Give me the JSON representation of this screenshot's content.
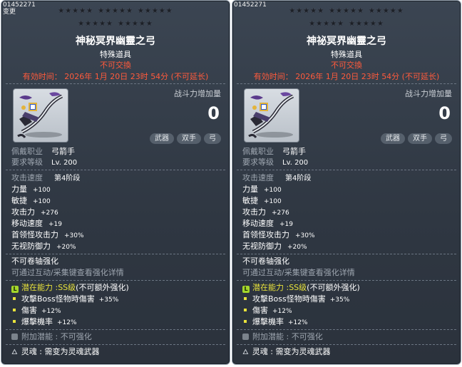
{
  "tooltips": [
    {
      "code": "01452271",
      "sub_code": "变更",
      "stars": [
        "★★★★★",
        "★★★★★",
        "★★★★★",
        "★★★★★",
        "★★★★★"
      ],
      "name": "神秘冥界幽靈之弓",
      "category": "特殊道具",
      "no_trade": "不可交換",
      "expire": "有効时间：  2026年  1月  20日  23时  54分  (不可延长)",
      "power_label": "战斗力增加量",
      "power_value": "0",
      "tags": [
        "武器",
        "双手",
        "弓"
      ],
      "job_label": "佩戴职业",
      "job_value": "弓箭手",
      "level_label": "要求等级",
      "level_value": "Lv. 200",
      "speed_label": "攻击速度",
      "speed_value": "第4阶段",
      "stats": [
        {
          "k": "力量",
          "v": "+100"
        },
        {
          "k": "敏捷",
          "v": "+100"
        },
        {
          "k": "攻击力",
          "v": "+276"
        },
        {
          "k": "移动速度",
          "v": "+19"
        },
        {
          "k": "首领怪攻击力",
          "v": "+30%"
        },
        {
          "k": "无视防御力",
          "v": "+20%"
        }
      ],
      "no_scroll": "不可卷轴强化",
      "scroll_hint": "可通过互动/采集键查看强化详情",
      "potential_label": "潜在能力 : ",
      "potential_grade": "SS级",
      "potential_note": "(不可额外强化)",
      "potentials": [
        {
          "k": "攻擊Boss怪物時傷害",
          "v": "+35%"
        },
        {
          "k": "傷害",
          "v": "+12%"
        },
        {
          "k": "爆擊機率",
          "v": "+12%"
        }
      ],
      "extra_potential": "附加潜能 :  不可强化",
      "soul": "灵魂 :  需变为灵魂武器"
    },
    {
      "code": "01452271",
      "sub_code": "",
      "stars": [
        "★★★★★",
        "★★★★★",
        "★★★★★",
        "★★★★★",
        "★★★★★"
      ],
      "name": "神祕冥界幽靈之弓",
      "category": "特殊道具",
      "no_trade": "不可交換",
      "expire": "有効时间：  2026年  1月  20日  23时  54分  (不可延长)",
      "power_label": "战斗力增加量",
      "power_value": "0",
      "tags": [
        "武器",
        "双手",
        "弓"
      ],
      "job_label": "佩戴职业",
      "job_value": "弓箭手",
      "level_label": "要求等级",
      "level_value": "Lv. 200",
      "speed_label": "攻击速度",
      "speed_value": "第4阶段",
      "stats": [
        {
          "k": "力量",
          "v": "+100"
        },
        {
          "k": "敏捷",
          "v": "+100"
        },
        {
          "k": "攻击力",
          "v": "+276"
        },
        {
          "k": "移动速度",
          "v": "+19"
        },
        {
          "k": "首领怪攻击力",
          "v": "+30%"
        },
        {
          "k": "无视防御力",
          "v": "+20%"
        }
      ],
      "no_scroll": "不可卷轴强化",
      "scroll_hint": "可通过互动/采集键查看强化详情",
      "potential_label": "潜在能力 : ",
      "potential_grade": "SS级",
      "potential_note": "(不可额外强化)",
      "potentials": [
        {
          "k": "攻擊Boss怪物時傷害",
          "v": "+35%"
        },
        {
          "k": "傷害",
          "v": "+12%"
        },
        {
          "k": "爆擊機率",
          "v": "+12%"
        }
      ],
      "extra_potential": "附加潜能 :  不可强化",
      "soul": "灵魂 :  需变为灵魂武器"
    }
  ]
}
